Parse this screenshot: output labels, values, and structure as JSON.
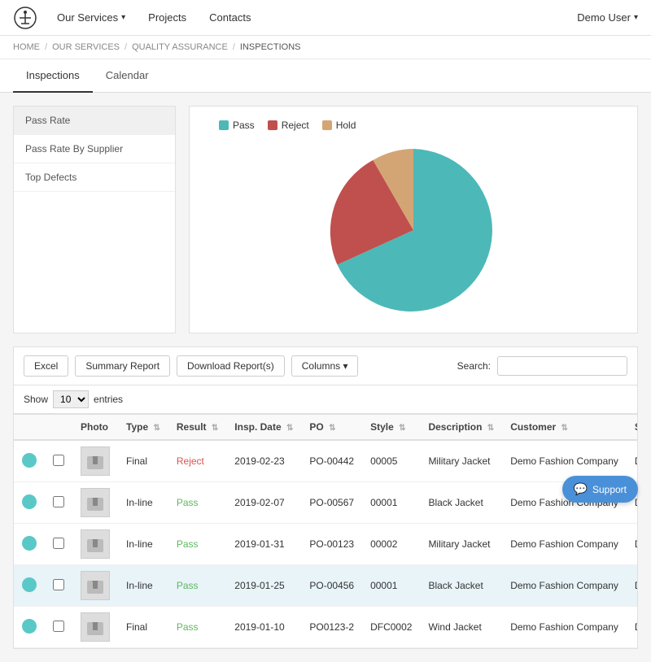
{
  "navbar": {
    "logo_alt": "anchor",
    "items": [
      {
        "label": "Our Services",
        "has_dropdown": true
      },
      {
        "label": "Projects"
      },
      {
        "label": "Contacts"
      }
    ],
    "user": "Demo User"
  },
  "breadcrumb": {
    "items": [
      "HOME",
      "OUR SERVICES",
      "QUALITY ASSURANCE",
      "INSPECTIONS"
    ],
    "separator": "/"
  },
  "tabs": [
    {
      "label": "Inspections",
      "active": true
    },
    {
      "label": "Calendar",
      "active": false
    }
  ],
  "chart_sidebar": {
    "items": [
      {
        "label": "Pass Rate",
        "active": true
      },
      {
        "label": "Pass Rate By Supplier",
        "active": false
      },
      {
        "label": "Top Defects",
        "active": false
      }
    ]
  },
  "chart": {
    "legend": [
      {
        "label": "Pass",
        "color": "#4db8b8"
      },
      {
        "label": "Reject",
        "color": "#c0504d"
      },
      {
        "label": "Hold",
        "color": "#d4a574"
      }
    ],
    "segments": [
      {
        "label": "Pass",
        "value": 75,
        "color": "#4db8b8"
      },
      {
        "label": "Reject",
        "value": 18,
        "color": "#c0504d"
      },
      {
        "label": "Hold",
        "value": 7,
        "color": "#d4a574"
      }
    ]
  },
  "toolbar": {
    "excel_label": "Excel",
    "summary_label": "Summary Report",
    "download_label": "Download Report(s)",
    "columns_label": "Columns ▾",
    "search_label": "Search:",
    "search_placeholder": "",
    "show_label": "Show",
    "show_value": "10",
    "entries_label": "entries"
  },
  "table": {
    "columns": [
      {
        "label": ""
      },
      {
        "label": "Photo"
      },
      {
        "label": "Type"
      },
      {
        "label": "Result"
      },
      {
        "label": "Insp. Date"
      },
      {
        "label": "PO"
      },
      {
        "label": "Style"
      },
      {
        "label": "Description"
      },
      {
        "label": "Customer"
      },
      {
        "label": "Supplier"
      }
    ],
    "rows": [
      {
        "highlighted": false,
        "type": "Final",
        "result": "Reject",
        "result_class": "status-reject",
        "insp_date": "2019-02-23",
        "po": "PO-00442",
        "style": "00005",
        "description": "Military Jacket",
        "customer": "Demo Fashion Company",
        "supplier": "Demo Quality Manufacturer"
      },
      {
        "highlighted": false,
        "type": "In-line",
        "result": "Pass",
        "result_class": "status-pass",
        "insp_date": "2019-02-07",
        "po": "PO-00567",
        "style": "00001",
        "description": "Black Jacket",
        "customer": "Demo Fashion Company",
        "supplier": "Demo Quality Clothes"
      },
      {
        "highlighted": false,
        "type": "In-line",
        "result": "Pass",
        "result_class": "status-pass",
        "insp_date": "2019-01-31",
        "po": "PO-00123",
        "style": "00002",
        "description": "Military Jacket",
        "customer": "Demo Fashion Company",
        "supplier": "Demo Quality Manufacturer"
      },
      {
        "highlighted": true,
        "type": "In-line",
        "result": "Pass",
        "result_class": "status-pass",
        "insp_date": "2019-01-25",
        "po": "PO-00456",
        "style": "00001",
        "description": "Black Jacket",
        "customer": "Demo Fashion Company",
        "supplier": "Demo Fashion Company"
      },
      {
        "highlighted": false,
        "type": "Final",
        "result": "Pass",
        "result_class": "status-pass",
        "insp_date": "2019-01-10",
        "po": "PO0123-2",
        "style": "DFC0002",
        "description": "Wind Jacket",
        "customer": "Demo Fashion Company",
        "supplier": "Demo Fashion C..."
      }
    ]
  },
  "support": {
    "label": "Support"
  }
}
